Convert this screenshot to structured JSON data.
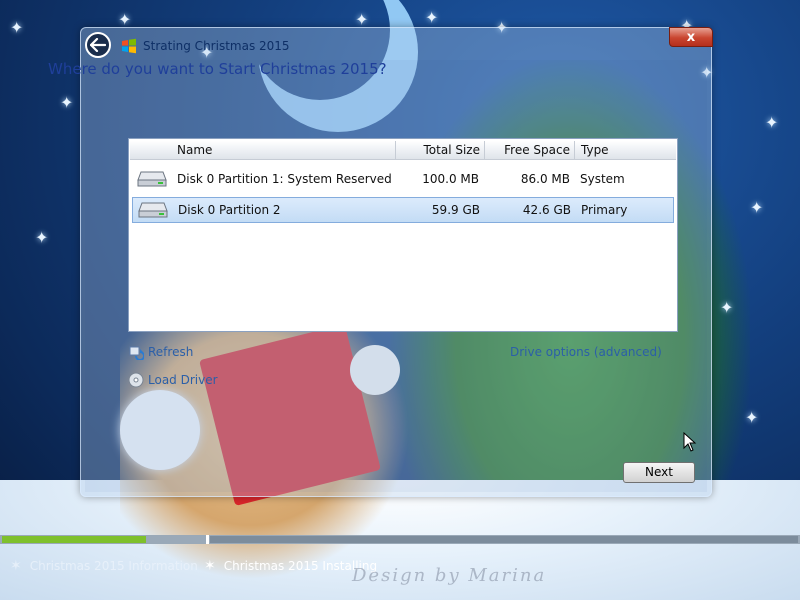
{
  "window": {
    "title": "Strating Christmas 2015",
    "close_label": "x",
    "question": "Where do you want to Start Christmas 2015?"
  },
  "table": {
    "columns": [
      "Name",
      "Total Size",
      "Free Space",
      "Type"
    ],
    "rows": [
      {
        "name": "Disk 0 Partition 1: System Reserved",
        "total": "100.0 MB",
        "free": "86.0 MB",
        "type": "System"
      },
      {
        "name": "Disk 0 Partition 2",
        "total": "59.9 GB",
        "free": "42.6 GB",
        "type": "Primary"
      }
    ],
    "selected_row": 1
  },
  "links": {
    "refresh": "Refresh",
    "load_driver": "Load Driver",
    "drive_options": "Drive options (advanced)"
  },
  "buttons": {
    "next": "Next"
  },
  "progress": {
    "steps": [
      {
        "label": "Christmas 2015 Information",
        "state": "done"
      },
      {
        "label": "Christmas 2015 Installing",
        "state": "current"
      }
    ],
    "fill_fraction": 0.18
  },
  "watermark": "Design by Marina",
  "colors": {
    "accent_blue": "#1f3f9a",
    "link_blue": "#2b5fa8",
    "progress_green": "#7ec02c",
    "close_red": "#c9452f",
    "selection": "#c3dcf5"
  },
  "icons": {
    "back": "back-arrow-icon",
    "app": "windows-logo-icon",
    "disk": "hard-disk-icon",
    "refresh": "refresh-icon",
    "load_driver": "cd-icon"
  }
}
